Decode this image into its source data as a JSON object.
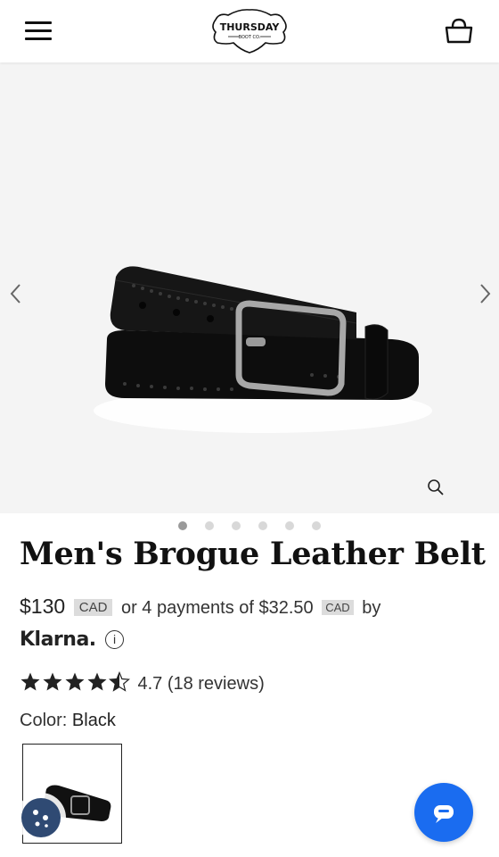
{
  "header": {
    "menu_icon": "hamburger-menu-icon",
    "logo": {
      "line1": "THURSDAY",
      "line2": "BOOT CO."
    },
    "bag_icon": "shopping-bag-icon"
  },
  "gallery": {
    "prev_icon": "chevron-left-icon",
    "next_icon": "chevron-right-icon",
    "zoom_icon": "magnifier-icon",
    "slide_count": 6,
    "active_slide": 1
  },
  "product": {
    "title": "Men's Brogue Leather Belt",
    "price": "$130",
    "currency": "CAD",
    "installment_prefix": "or 4 payments of",
    "installment_amount": "$32.50",
    "installment_currency": "CAD",
    "by_label": "by",
    "klarna_label": "Klarna.",
    "info_symbol": "i",
    "rating_value": 4.7,
    "rating_text": "4.7 (18 reviews)",
    "color_label": "Color:",
    "color_value": "Black"
  },
  "colors": {
    "brand_blue": "#1a6cf0",
    "cookie_navy": "#2f4a73",
    "badge_gray": "#dcdcdc"
  }
}
